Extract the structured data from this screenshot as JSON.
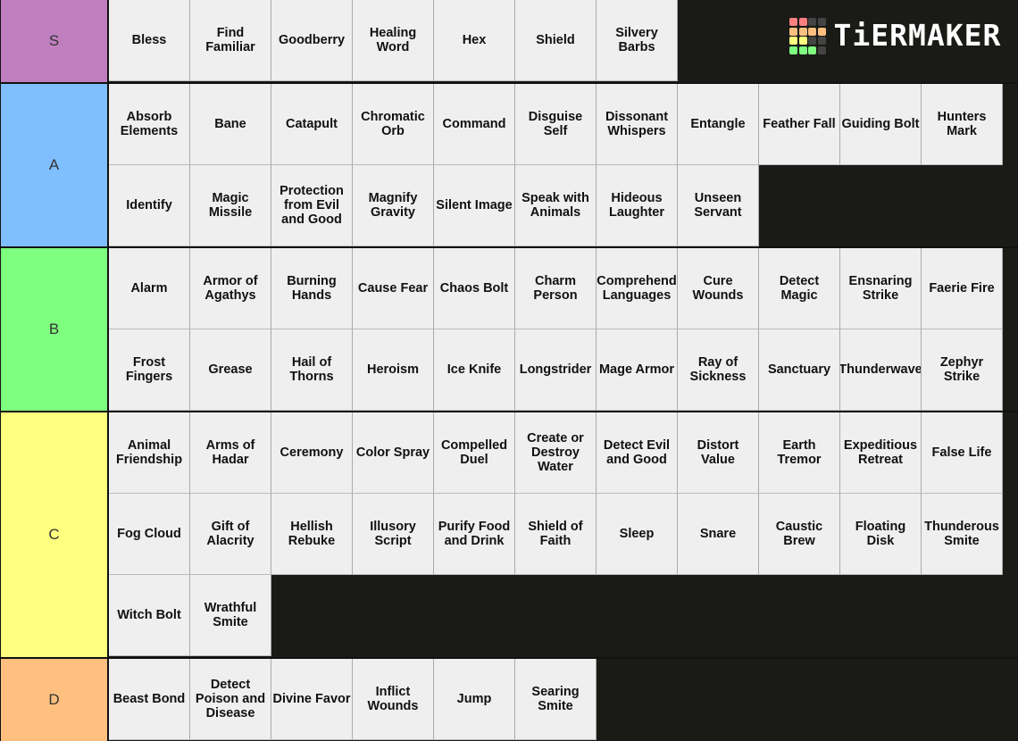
{
  "logo": {
    "text": "TiERMAKER",
    "grid_colors": [
      "#ff7f7f",
      "#ff7f7f",
      "#444444",
      "#444444",
      "#ffbf7f",
      "#ffbf7f",
      "#ffbf7f",
      "#ffbf7f",
      "#ffff7f",
      "#ffff7f",
      "#444444",
      "#444444",
      "#7fff7f",
      "#7fff7f",
      "#7fff7f",
      "#444444"
    ]
  },
  "tiers": [
    {
      "label": "S",
      "color": "#bf7fbf",
      "items": [
        "Bless",
        "Find Familiar",
        "Goodberry",
        "Healing Word",
        "Hex",
        "Shield",
        "Silvery Barbs"
      ]
    },
    {
      "label": "A",
      "color": "#7fbfff",
      "items": [
        "Absorb Elements",
        "Bane",
        "Catapult",
        "Chromatic Orb",
        "Command",
        "Disguise Self",
        "Dissonant Whispers",
        "Entangle",
        "Feather Fall",
        "Guiding Bolt",
        "Hunters Mark",
        "Identify",
        "Magic Missile",
        "Protection from Evil and Good",
        "Magnify Gravity",
        "Silent Image",
        "Speak with Animals",
        "Hideous Laughter",
        "Unseen Servant"
      ]
    },
    {
      "label": "B",
      "color": "#7fff7f",
      "items": [
        "Alarm",
        "Armor of Agathys",
        "Burning Hands",
        "Cause Fear",
        "Chaos Bolt",
        "Charm Person",
        "Comprehend Languages",
        "Cure Wounds",
        "Detect Magic",
        "Ensnaring Strike",
        "Faerie Fire",
        "Frost Fingers",
        "Grease",
        "Hail of Thorns",
        "Heroism",
        "Ice Knife",
        "Longstrider",
        "Mage Armor",
        "Ray of Sickness",
        "Sanctuary",
        "Thunderwave",
        "Zephyr Strike"
      ]
    },
    {
      "label": "C",
      "color": "#ffff7f",
      "items": [
        "Animal Friendship",
        "Arms of Hadar",
        "Ceremony",
        "Color Spray",
        "Compelled Duel",
        "Create or Destroy Water",
        "Detect Evil and Good",
        "Distort Value",
        "Earth Tremor",
        "Expeditious Retreat",
        "False Life",
        "Fog Cloud",
        "Gift of Alacrity",
        "Hellish Rebuke",
        "Illusory Script",
        "Purify Food and Drink",
        "Shield of Faith",
        "Sleep",
        "Snare",
        "Caustic Brew",
        "Floating Disk",
        "Thunderous Smite",
        "Witch Bolt",
        "Wrathful Smite"
      ]
    },
    {
      "label": "D",
      "color": "#ffbf7f",
      "items": [
        "Beast Bond",
        "Detect Poison and Disease",
        "Divine Favor",
        "Inflict Wounds",
        "Jump",
        "Searing Smite"
      ]
    }
  ]
}
